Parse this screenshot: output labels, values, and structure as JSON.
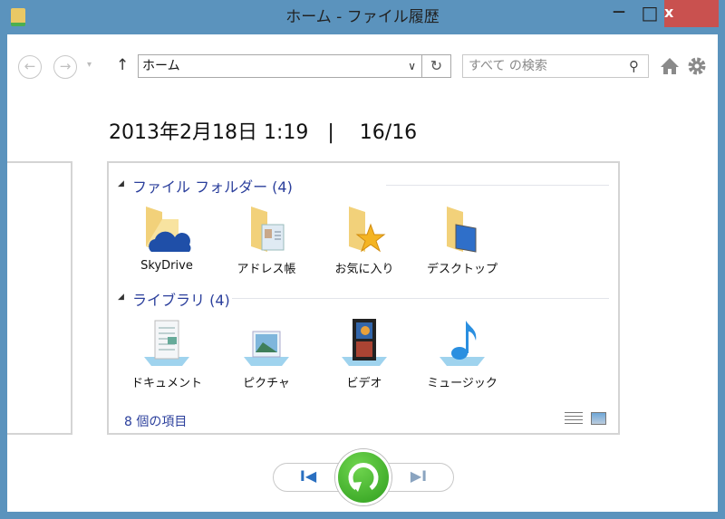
{
  "window": {
    "title": "ホーム - ファイル履歴",
    "minimize": "—",
    "maximize": "□",
    "close": "x"
  },
  "toolbar": {
    "back": "←",
    "forward": "→",
    "dropdown": "▾",
    "up": "↑",
    "address": "ホーム",
    "address_chevron": "∨",
    "refresh": "↻",
    "search_placeholder": "すべて の検索",
    "search_icon": "⚲"
  },
  "header": {
    "date": "2013年2月18日 1:19",
    "separator": "|",
    "position": "16/16"
  },
  "sections": [
    {
      "title": "ファイル フォルダー (4)",
      "items": [
        {
          "label": "SkyDrive",
          "icon": "skydrive-folder"
        },
        {
          "label": "アドレス帳",
          "icon": "contacts-folder"
        },
        {
          "label": "お気に入り",
          "icon": "favorites-folder"
        },
        {
          "label": "デスクトップ",
          "icon": "desktop-folder"
        }
      ]
    },
    {
      "title": "ライブラリ (4)",
      "items": [
        {
          "label": "ドキュメント",
          "icon": "documents-library"
        },
        {
          "label": "ピクチャ",
          "icon": "pictures-library"
        },
        {
          "label": "ビデオ",
          "icon": "videos-library"
        },
        {
          "label": "ミュージック",
          "icon": "music-library"
        }
      ]
    }
  ],
  "status": {
    "count": "8 個の項目"
  },
  "playback": {
    "previous": "I◀",
    "next": "▶I"
  },
  "colors": {
    "border": "#5b93bd",
    "close": "#c9514f",
    "accent": "#2b3f9c",
    "restore": "#3fae2a"
  }
}
